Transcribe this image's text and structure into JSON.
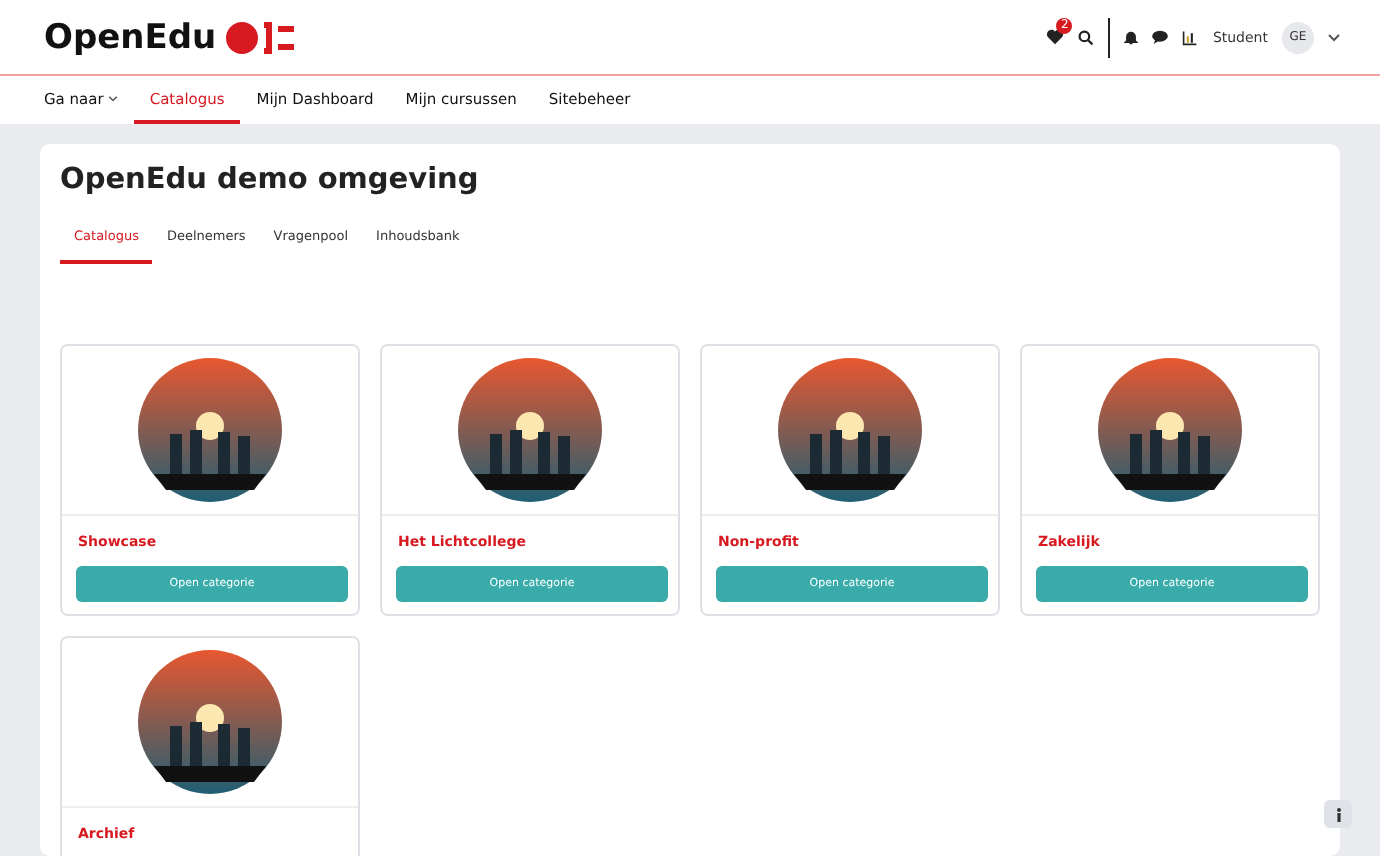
{
  "header": {
    "logo": "OpenEdu",
    "notification_count": "2",
    "user_role": "Student",
    "avatar_initials": "GE"
  },
  "nav": [
    {
      "label": "Ga naar",
      "dropdown": true,
      "selected": false
    },
    {
      "label": "Catalogus",
      "dropdown": false,
      "selected": true
    },
    {
      "label": "Mijn Dashboard",
      "dropdown": false,
      "selected": false
    },
    {
      "label": "Mijn cursussen",
      "dropdown": false,
      "selected": false
    },
    {
      "label": "Sitebeheer",
      "dropdown": false,
      "selected": false
    }
  ],
  "page": {
    "title": "OpenEdu demo omgeving",
    "tabs": [
      {
        "label": "Catalogus",
        "selected": true
      },
      {
        "label": "Deelnemers",
        "selected": false
      },
      {
        "label": "Vragenpool",
        "selected": false
      },
      {
        "label": "Inhoudsbank",
        "selected": false
      }
    ],
    "categories": [
      {
        "name": "Showcase",
        "button": "Open categorie"
      },
      {
        "name": "Het Lichtcollege",
        "button": "Open categorie"
      },
      {
        "name": "Non-profit",
        "button": "Open categorie"
      },
      {
        "name": "Zakelijk",
        "button": "Open categorie"
      },
      {
        "name": "Archief"
      }
    ]
  }
}
